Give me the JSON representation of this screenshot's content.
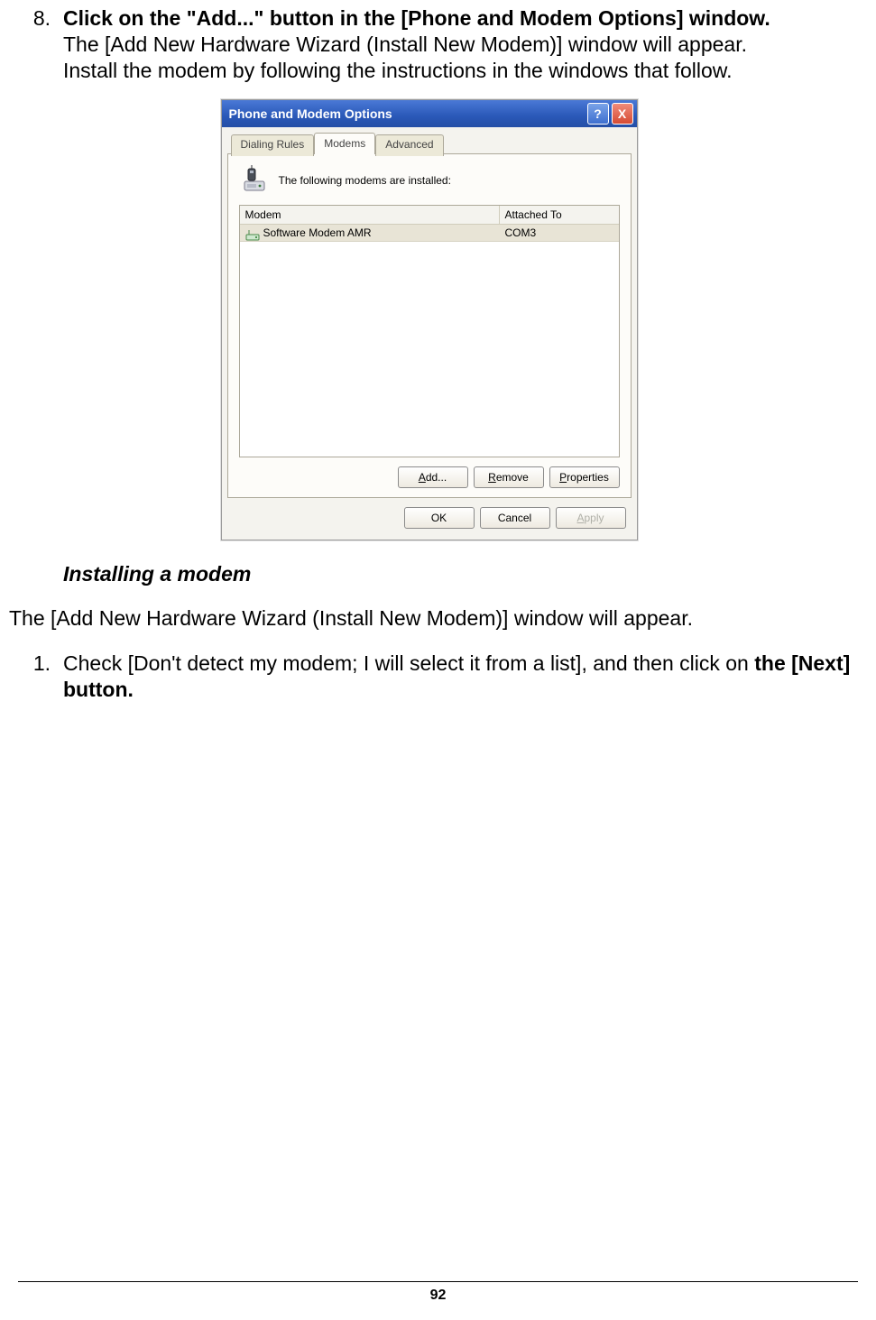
{
  "step8": {
    "number": "8.",
    "bold_line": "Click on the \"Add...\" button in the [Phone and Modem Options] window.",
    "body_line1": "The [Add New Hardware Wizard (Install New Modem)] window will appear.",
    "body_line2": "Install the modem by following the instructions in the windows that follow."
  },
  "dialog": {
    "title": "Phone and Modem Options",
    "help_glyph": "?",
    "close_glyph": "X",
    "tabs": {
      "dialing": "Dialing Rules",
      "modems": "Modems",
      "advanced": "Advanced"
    },
    "panel_text": "The following modems are  installed:",
    "columns": {
      "modem": "Modem",
      "attached": "Attached To"
    },
    "row": {
      "name": "Software Modem AMR",
      "port": "COM3"
    },
    "buttons": {
      "add_pre": "A",
      "add_rest": "dd...",
      "remove_pre": "R",
      "remove_rest": "emove",
      "props_pre": "P",
      "props_rest": "roperties",
      "ok": "OK",
      "cancel": "Cancel",
      "apply_pre": "A",
      "apply_rest": "pply"
    }
  },
  "section_heading": "Installing a modem",
  "paragraph": "The [Add New Hardware Wizard (Install New Modem)] window will appear.",
  "step1": {
    "number": "1.",
    "bold_line1": "Check [Don't detect my modem; I will select it from a list], and then click on",
    "bold_line2": "the [Next] button."
  },
  "page_number": "92"
}
